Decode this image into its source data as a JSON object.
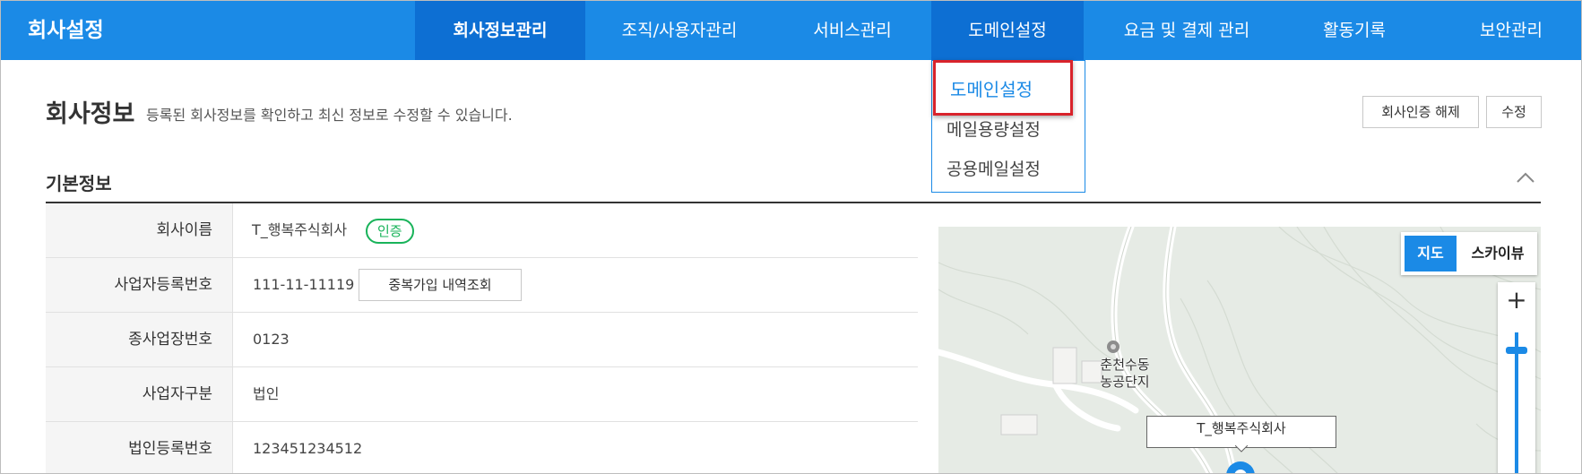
{
  "app": {
    "title": "회사설정"
  },
  "nav": {
    "tabs": [
      {
        "label": "회사정보관리"
      },
      {
        "label": "조직/사용자관리"
      },
      {
        "label": "서비스관리"
      },
      {
        "label": "도메인설정"
      },
      {
        "label": "요금 및 결제 관리"
      },
      {
        "label": "활동기록"
      },
      {
        "label": "보안관리"
      }
    ],
    "dropdown": [
      "도메인설정",
      "메일용량설정",
      "공용메일설정"
    ]
  },
  "page": {
    "title": "회사정보",
    "description": "등록된 회사정보를 확인하고 최신 정보로 수정할 수 있습니다.",
    "buttons": {
      "revoke": "회사인증 해제",
      "edit": "수정"
    }
  },
  "section": {
    "title": "기본정보"
  },
  "info": [
    {
      "label": "회사이름",
      "value": "T_행복주식회사",
      "badge": "인증"
    },
    {
      "label": "사업자등록번호",
      "value": "111-11-11119",
      "button": "중복가입 내역조회"
    },
    {
      "label": "종사업장번호",
      "value": "0123"
    },
    {
      "label": "사업자구분",
      "value": "법인"
    },
    {
      "label": "법인등록번호",
      "value": "123451234512"
    }
  ],
  "map": {
    "toggle": {
      "map": "지도",
      "sky": "스카이뷰"
    },
    "zoom_in": "+",
    "place_name": "춘천수동\n농공단지",
    "marker_label": "T_행복주식회사"
  },
  "colors": {
    "primary": "#1b8ae6",
    "primary_dark": "#0d6fd3",
    "badge": "#19b35a",
    "highlight": "#d9232b"
  }
}
